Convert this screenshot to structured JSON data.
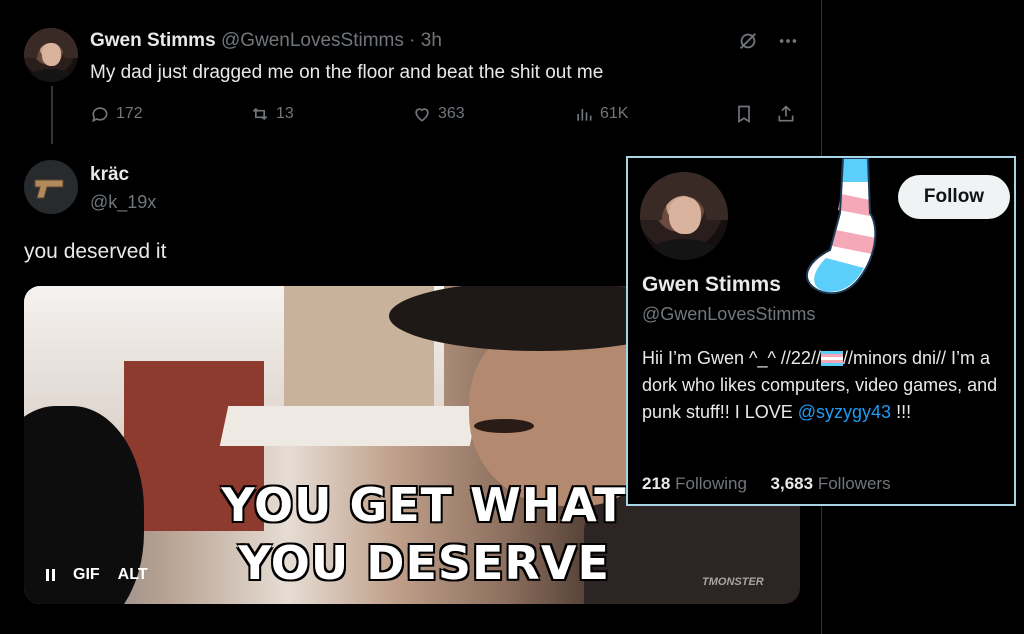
{
  "post": {
    "author_name": "Gwen Stimms",
    "author_handle": "@GwenLovesStimms",
    "separator": "·",
    "time": "3h",
    "text": "My dad just dragged me on the floor and beat the shit out me",
    "stats": {
      "replies": "172",
      "reposts": "13",
      "likes": "363",
      "views": "61K"
    }
  },
  "reply": {
    "author_name": "kräc",
    "author_handle": "@k_19x",
    "text": "you deserved it",
    "media": {
      "caption_line1": "YOU GET WHAT",
      "caption_line2": "YOU DESERVE",
      "watermark": "TMONSTER",
      "gif_label": "GIF",
      "alt_label": "ALT"
    }
  },
  "profile_card": {
    "follow_label": "Follow",
    "name": "Gwen Stimms",
    "handle": "@GwenLovesStimms",
    "bio_part1": "Hii I’m Gwen ^_^ //22//",
    "bio_part2": "//minors dni// I’m a dork who likes computers, video games, and punk stuff!! I LOVE",
    "bio_mention": "@syzygy43",
    "bio_part3": "!!!",
    "following_count": "218",
    "following_label": "Following",
    "followers_count": "3,683",
    "followers_label": "Followers",
    "border_color": "#a8d5e5"
  },
  "icons": [
    "grok-icon",
    "more-icon",
    "reply-icon",
    "repost-icon",
    "like-icon",
    "views-icon",
    "bookmark-icon",
    "share-icon",
    "pause-icon",
    "trans-flag-icon"
  ]
}
